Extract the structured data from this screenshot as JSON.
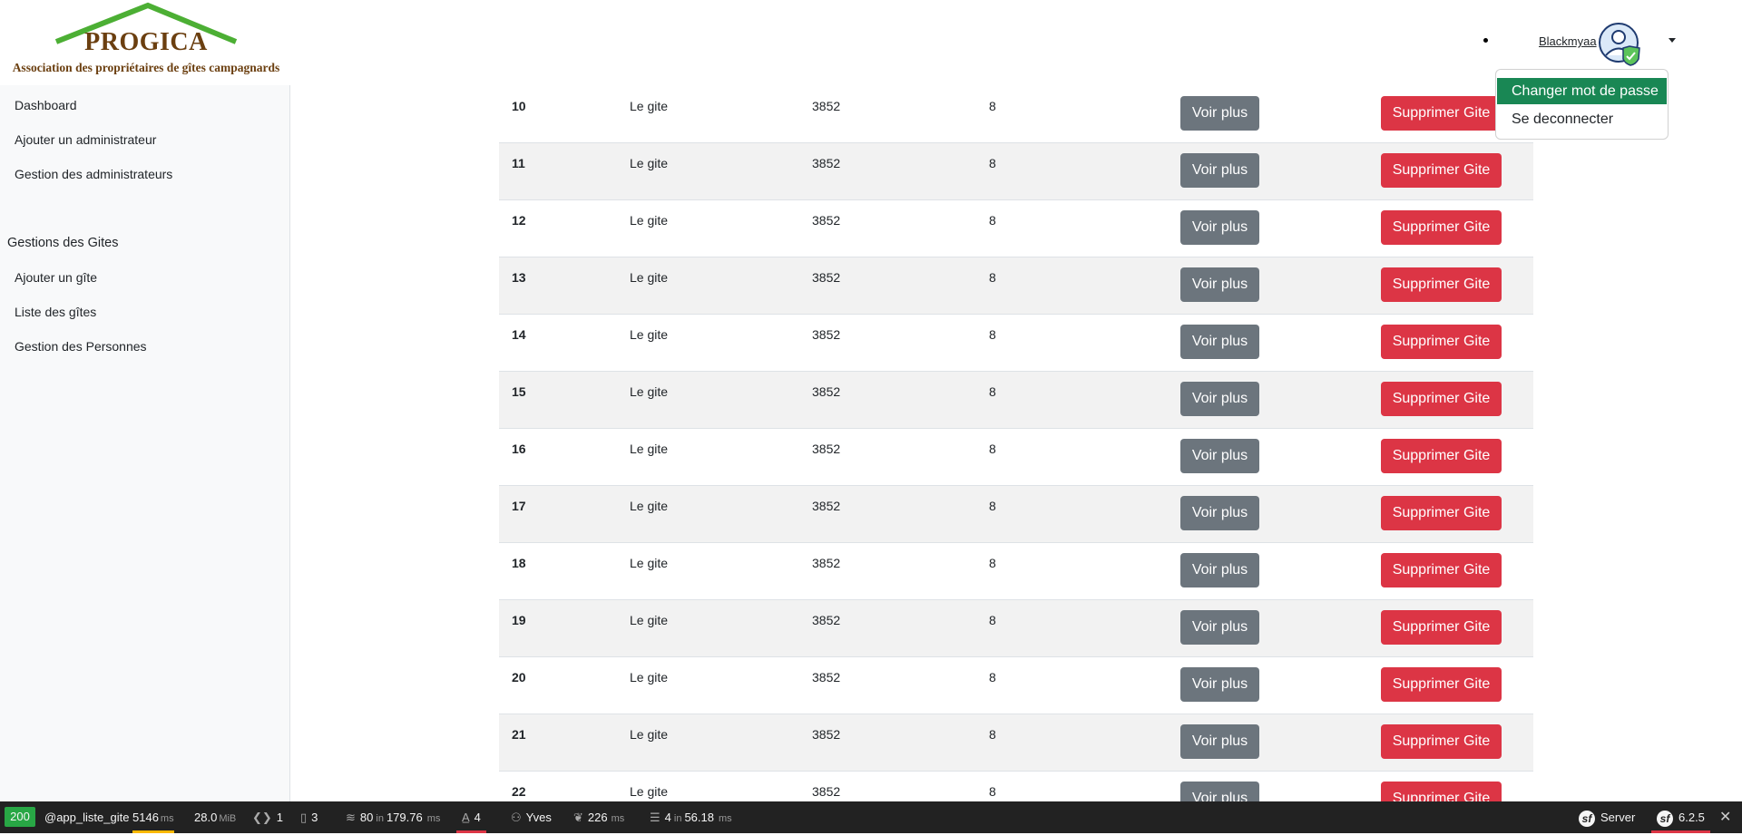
{
  "brand": {
    "title": "PROGICA",
    "subtitle": "Association des propriétaires de gîtes campagnards",
    "roof_color": "#4caf34",
    "text_color": "#6b3f10"
  },
  "sidebar": {
    "items": [
      {
        "label": "Dashboard"
      },
      {
        "label": "Ajouter un administrateur"
      },
      {
        "label": "Gestion des administrateurs"
      }
    ],
    "section_heading": "Gestions des Gites",
    "section_items": [
      {
        "label": "Ajouter un gîte"
      },
      {
        "label": "Liste des gîtes"
      },
      {
        "label": "Gestion des Personnes"
      }
    ]
  },
  "header": {
    "username": "Blackmyaa",
    "avatar_icon": "user-verified-icon"
  },
  "user_menu": {
    "items": [
      {
        "label": "Changer mot de passe",
        "active": true
      },
      {
        "label": "Se deconnecter",
        "active": false
      }
    ],
    "active_color": "#198754"
  },
  "table": {
    "buttons": {
      "view_label": "Voir plus",
      "delete_label": "Supprimer Gite"
    },
    "colors": {
      "view": "#6c757d",
      "delete": "#dc3545"
    },
    "rows": [
      {
        "id": "10",
        "name": "Le gite",
        "number": "3852",
        "capacity": "8"
      },
      {
        "id": "11",
        "name": "Le gite",
        "number": "3852",
        "capacity": "8"
      },
      {
        "id": "12",
        "name": "Le gite",
        "number": "3852",
        "capacity": "8"
      },
      {
        "id": "13",
        "name": "Le gite",
        "number": "3852",
        "capacity": "8"
      },
      {
        "id": "14",
        "name": "Le gite",
        "number": "3852",
        "capacity": "8"
      },
      {
        "id": "15",
        "name": "Le gite",
        "number": "3852",
        "capacity": "8"
      },
      {
        "id": "16",
        "name": "Le gite",
        "number": "3852",
        "capacity": "8"
      },
      {
        "id": "17",
        "name": "Le gite",
        "number": "3852",
        "capacity": "8"
      },
      {
        "id": "18",
        "name": "Le gite",
        "number": "3852",
        "capacity": "8"
      },
      {
        "id": "19",
        "name": "Le gite",
        "number": "3852",
        "capacity": "8"
      },
      {
        "id": "20",
        "name": "Le gite",
        "number": "3852",
        "capacity": "8"
      },
      {
        "id": "21",
        "name": "Le gite",
        "number": "3852",
        "capacity": "8"
      },
      {
        "id": "22",
        "name": "Le gite",
        "number": "3852",
        "capacity": "8"
      }
    ]
  },
  "debug_toolbar": {
    "status_code": "200",
    "route": "@app_liste_gite",
    "time_value": "5146",
    "time_unit": "ms",
    "memory_value": "28.0",
    "memory_unit": "MiB",
    "logs_count": "1",
    "forms_count": "3",
    "cache_calls": "80",
    "cache_in": "in",
    "cache_time": "179.76",
    "cache_unit": "ms",
    "translation_count": "4",
    "user": "Yves",
    "twig_time": "226",
    "twig_unit": "ms",
    "db_queries": "4",
    "db_in": "in",
    "db_time": "56.18",
    "db_unit": "ms",
    "server_label": "Server",
    "symfony_version": "6.2.5",
    "status_color": "#28a745"
  }
}
